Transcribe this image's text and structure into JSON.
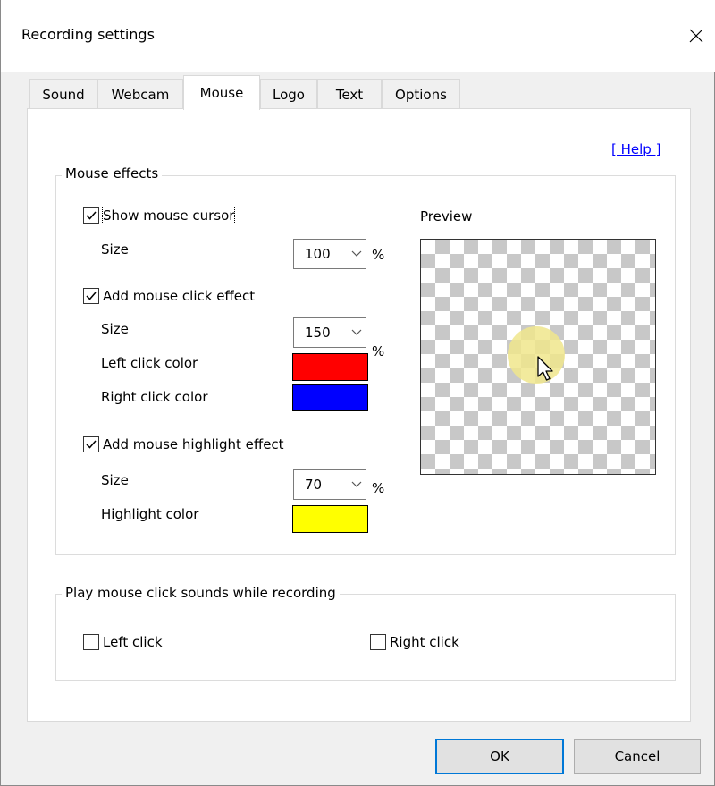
{
  "window": {
    "title": "Recording settings"
  },
  "tabs": [
    {
      "label": "Sound",
      "active": false
    },
    {
      "label": "Webcam",
      "active": false
    },
    {
      "label": "Mouse",
      "active": true
    },
    {
      "label": "Logo",
      "active": false
    },
    {
      "label": "Text",
      "active": false
    },
    {
      "label": "Options",
      "active": false
    }
  ],
  "help_link": "[ Help ]",
  "mouse_effects": {
    "legend": "Mouse effects",
    "show_cursor": {
      "label": "Show mouse cursor",
      "checked": true,
      "size_label": "Size",
      "size_value": "100",
      "unit": "%"
    },
    "click_effect": {
      "label": "Add mouse click effect",
      "checked": true,
      "size_label": "Size",
      "size_value": "150",
      "unit": "%",
      "left_color_label": "Left click color",
      "left_color": "#ff0000",
      "right_color_label": "Right click color",
      "right_color": "#0000ff"
    },
    "highlight_effect": {
      "label": "Add mouse highlight effect",
      "checked": true,
      "size_label": "Size",
      "size_value": "70",
      "unit": "%",
      "color_label": "Highlight color",
      "color": "#ffff00"
    },
    "preview_label": "Preview"
  },
  "click_sounds": {
    "legend": "Play mouse click sounds while recording",
    "left": {
      "label": "Left click",
      "checked": false
    },
    "right": {
      "label": "Right click",
      "checked": false
    }
  },
  "buttons": {
    "ok": "OK",
    "cancel": "Cancel"
  },
  "colors": {
    "accent": "#0078d7",
    "link": "#0000ff"
  }
}
